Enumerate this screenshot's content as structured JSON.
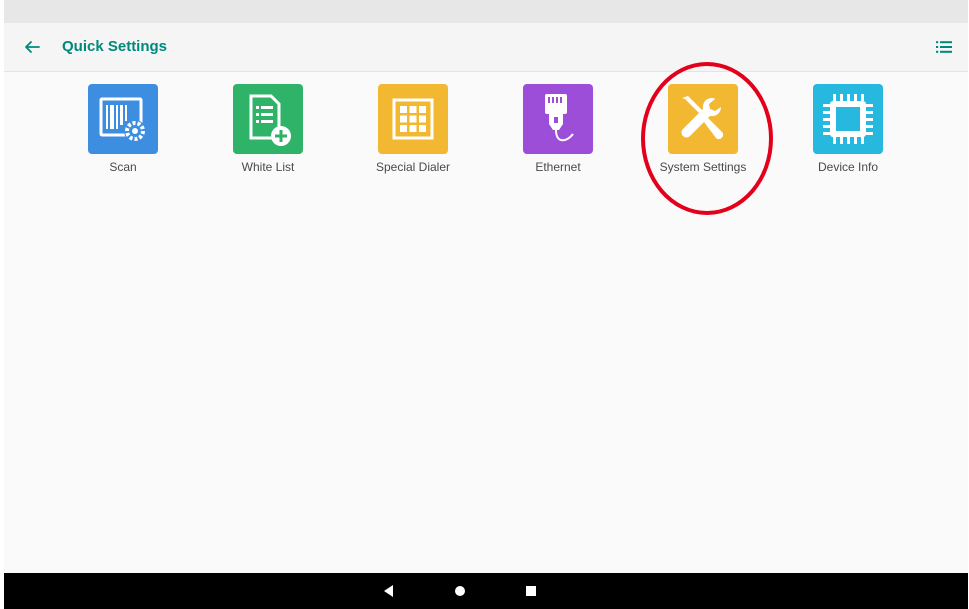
{
  "app_bar": {
    "title": "Quick Settings",
    "back_icon": "arrow-left-icon",
    "menu_icon": "list-icon",
    "accent_color": "#00897b"
  },
  "tiles": [
    {
      "label": "Scan",
      "icon": "barcode-scan-icon",
      "color": "#3d8ee0"
    },
    {
      "label": "White List",
      "icon": "document-add-icon",
      "color": "#2fb369"
    },
    {
      "label": "Special Dialer",
      "icon": "keypad-grid-icon",
      "color": "#f2b831"
    },
    {
      "label": "Ethernet",
      "icon": "ethernet-plug-icon",
      "color": "#9d4ed9"
    },
    {
      "label": "System Settings",
      "icon": "wrench-screwdriver-icon",
      "color": "#f2b831"
    },
    {
      "label": "Device Info",
      "icon": "chip-icon",
      "color": "#27b8df"
    }
  ],
  "annotation": {
    "target": "System Settings",
    "color": "#e3001b"
  },
  "nav_bar": {
    "back_icon": "triangle-back-icon",
    "home_icon": "circle-home-icon",
    "recents_icon": "square-recents-icon"
  }
}
